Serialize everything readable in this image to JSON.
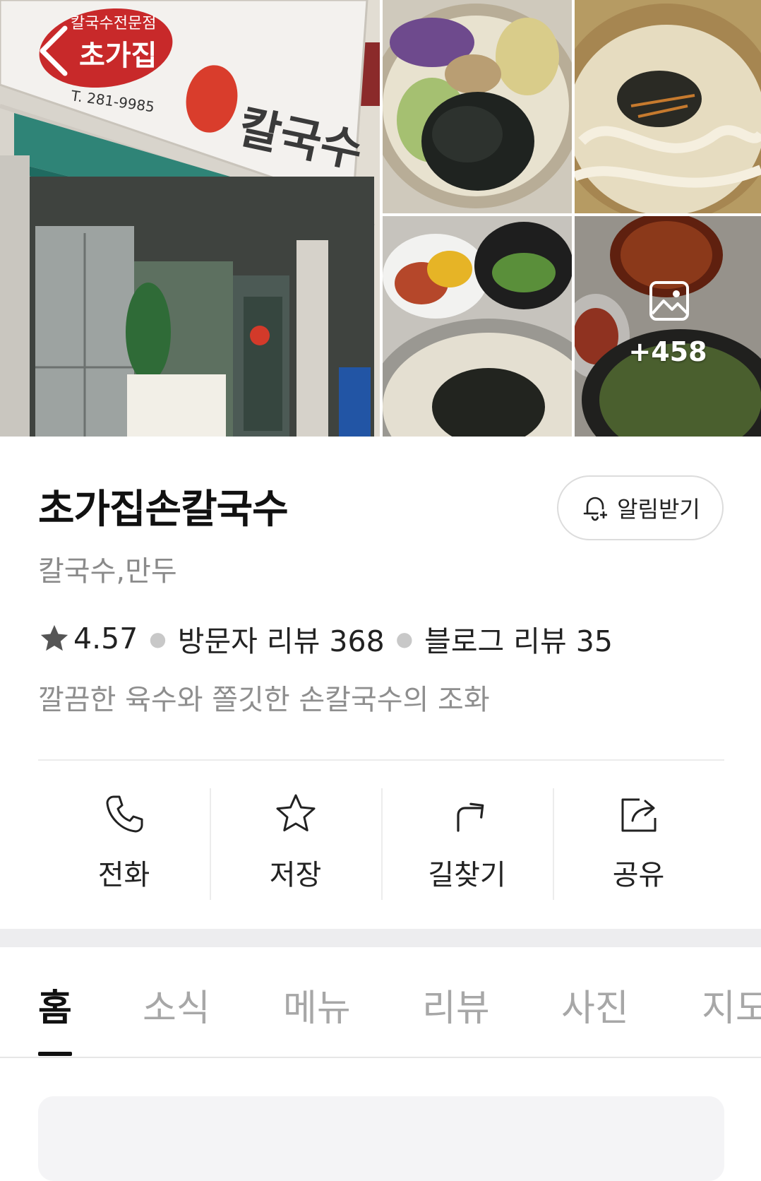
{
  "gallery": {
    "photo_count_label": "+458",
    "storefront": {
      "sign_top": "칼국수전문점",
      "sign_name": "초가집",
      "sign_phone": "T. 281-9985",
      "sign_main": "칼국수"
    }
  },
  "place": {
    "name": "초가집손칼국수",
    "category": "칼국수,만두",
    "rating": "4.57",
    "visitor_reviews": "방문자 리뷰 368",
    "blog_reviews": "블로그 리뷰 35",
    "tagline": "깔끔한 육수와 쫄깃한 손칼국수의 조화"
  },
  "alert_button": {
    "label": "알림받기",
    "icon": "bell-plus-icon"
  },
  "actions": [
    {
      "label": "전화",
      "icon": "phone-icon"
    },
    {
      "label": "저장",
      "icon": "star-outline-icon"
    },
    {
      "label": "길찾기",
      "icon": "directions-icon"
    },
    {
      "label": "공유",
      "icon": "share-icon"
    }
  ],
  "tabs": [
    {
      "label": "홈",
      "active": true
    },
    {
      "label": "소식",
      "active": false
    },
    {
      "label": "메뉴",
      "active": false
    },
    {
      "label": "리뷰",
      "active": false
    },
    {
      "label": "사진",
      "active": false
    },
    {
      "label": "지도",
      "active": false
    }
  ],
  "colors": {
    "text_primary": "#111111",
    "text_secondary": "#8a8a8a",
    "tab_inactive": "#a7a7a7",
    "divider": "#ececec"
  }
}
